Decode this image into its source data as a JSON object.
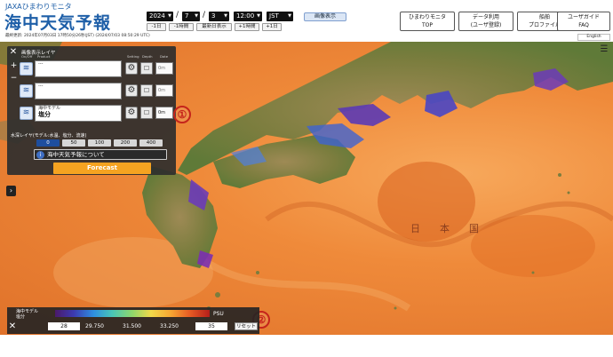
{
  "header": {
    "logo_small": "JAXAひまわりモニタ",
    "logo_title": "海中天気予報",
    "last_update": "最終更新: 2024年07月03日 17時50分26秒(JST) (2024/07/03 08:50:29 UTC)",
    "year": "2024",
    "month": "7",
    "day": "3",
    "time": "12:00",
    "timezone": "JST",
    "date_sep": "/",
    "image_display_btn": "画像表示",
    "minus_day": "-1日",
    "minus_hour": "-1時間",
    "latest_day": "最新日表示",
    "plus_hour": "+1時間",
    "plus_day": "+1日",
    "nav": [
      {
        "line1": "ひまわりモニタ",
        "line2": "TOP"
      },
      {
        "line1": "データ利用",
        "line2": "(ユーザ登録)"
      },
      {
        "line1": "船舶",
        "line2": "プロファイル"
      },
      {
        "line1": "ユーザガイド",
        "line2": "FAQ"
      }
    ],
    "english": "English"
  },
  "panel": {
    "title": "画像表示レイヤ",
    "col_onoff": "On/Off",
    "col_product": "Product",
    "col_settings": "Setting",
    "col_depth": "Depth",
    "col_date": "Date",
    "layer1_text": "---",
    "layer2_text": "---",
    "layer3_line1": "海中モデル",
    "layer3_line2": "塩分",
    "off_label": "0m",
    "layer3_depth": "0m",
    "depth_title": "水深レイヤ(モデル:水温、塩分、流速)",
    "depth_options": [
      "0",
      "50",
      "100",
      "200",
      "400"
    ],
    "info_link": "海中天気予報について",
    "forecast_btn": "Forecast",
    "zoom_in": "+",
    "zoom_out": "−"
  },
  "map": {
    "label": "日本国",
    "marker1": "①",
    "marker2": "②"
  },
  "legend": {
    "title_line1": "海中モデル",
    "title_line2": "塩分",
    "unit": "PSU",
    "min_value": "28",
    "ticks": [
      "29.750",
      "31.500",
      "33.250"
    ],
    "max_value": "35",
    "reset_btn": "リセット"
  },
  "colors": {
    "brand_blue": "#1e5fa8",
    "forecast_orange": "#f5a321",
    "active_depth": "#1e4e9e",
    "marker_red": "#c5241b"
  }
}
